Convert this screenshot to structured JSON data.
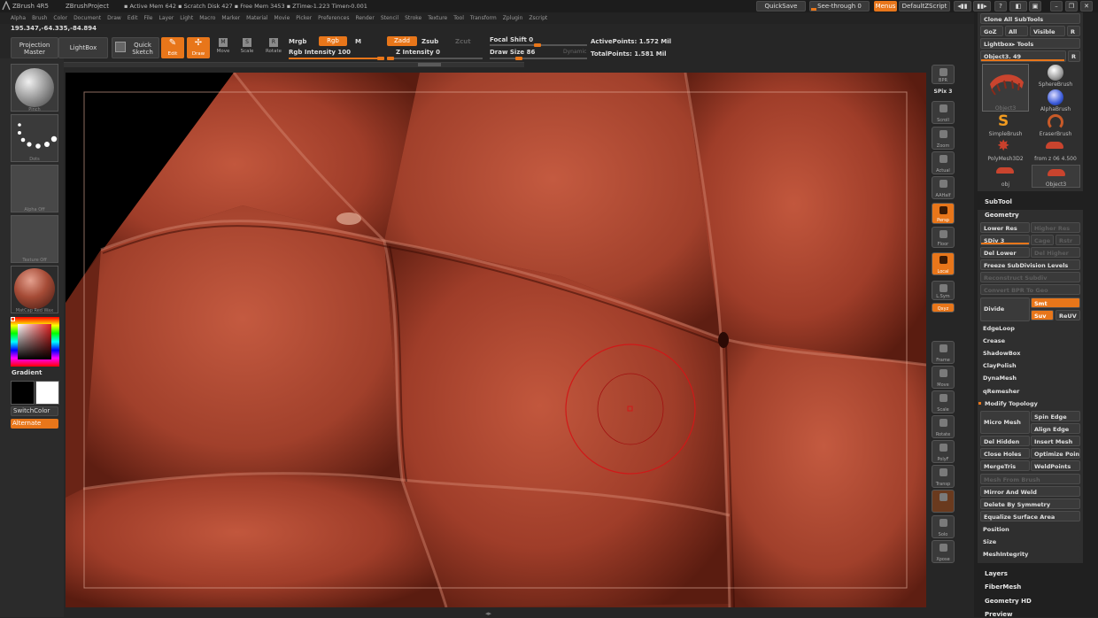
{
  "titlebar": {
    "app": "ZBrush 4R5",
    "project": "ZBrushProject",
    "stats": "▪ Active Mem 642  ▪ Scratch Disk 427  ▪ Free Mem 3453  ▪ ZTime▹1.223  Timer▹0.001",
    "quicksave": "QuickSave",
    "seethrough": "See-through   0",
    "menus": "Menus",
    "script": "DefaultZScript"
  },
  "menubar": [
    "Alpha",
    "Brush",
    "Color",
    "Document",
    "Draw",
    "Edit",
    "File",
    "Layer",
    "Light",
    "Macro",
    "Marker",
    "Material",
    "Movie",
    "Picker",
    "Preferences",
    "Render",
    "Stencil",
    "Stroke",
    "Texture",
    "Tool",
    "Transform",
    "Zplugin",
    "Zscript"
  ],
  "coords": "195.347,-64.335,-84.894",
  "toolbar": {
    "projection_master": "Projection Master",
    "lightbox": "LightBox",
    "quick_sketch": "Quick Sketch",
    "edit": "Edit",
    "draw": "Draw",
    "move": "Move",
    "scale": "Scale",
    "rotate": "Rotate",
    "mrgb": "Mrgb",
    "rgb": "Rgb",
    "m": "M",
    "rgb_intensity": "Rgb Intensity 100",
    "zadd": "Zadd",
    "zsub": "Zsub",
    "zcut": "Zcut",
    "z_intensity": "Z Intensity 0",
    "focal_shift": "Focal Shift 0",
    "draw_size": "Draw Size 86",
    "dynamic": "Dynamic",
    "active_points": "ActivePoints: 1.572  Mil",
    "total_points": "TotalPoints: 1.581  Mil"
  },
  "leftshelf": {
    "brush": "Pinch",
    "stroke": "Dots",
    "alpha": "Alpha Off",
    "texture": "Texture Off",
    "material": "MatCap Red Wax",
    "gradient": "Gradient",
    "switchcolor": "SwitchColor",
    "alternate": "Alternate"
  },
  "colors": {
    "accent": "#e8761a",
    "leather": "#9c3a26",
    "cursor": "#d01818"
  },
  "righttools": [
    {
      "id": "bpr",
      "label": "BPR",
      "on": false
    },
    {
      "id": "spix",
      "label": "SPix 3",
      "on": false
    },
    {
      "id": "scroll",
      "label": "Scroll",
      "on": false
    },
    {
      "id": "zoom",
      "label": "Zoom",
      "on": false
    },
    {
      "id": "actual",
      "label": "Actual",
      "on": false
    },
    {
      "id": "aahalf",
      "label": "AAHalf",
      "on": false
    },
    {
      "id": "persp",
      "label": "Persp",
      "on": true
    },
    {
      "id": "floor",
      "label": "Floor",
      "on": false
    },
    {
      "id": "local",
      "label": "Local",
      "on": true
    },
    {
      "id": "lsym",
      "label": "L.Sym",
      "on": false
    },
    {
      "id": "xyz",
      "label": "Qxyz",
      "on": true
    },
    {
      "id": "frame",
      "label": "Frame",
      "on": false
    },
    {
      "id": "move",
      "label": "Move",
      "on": false
    },
    {
      "id": "scale",
      "label": "Scale",
      "on": false
    },
    {
      "id": "rotate",
      "label": "Rotate",
      "on": false
    },
    {
      "id": "polyf",
      "label": "PolyF",
      "on": false
    },
    {
      "id": "transp",
      "label": "Transp",
      "on": false
    },
    {
      "id": "ghost",
      "label": "",
      "on": false
    },
    {
      "id": "solo",
      "label": "Solo",
      "on": false
    },
    {
      "id": "xpose",
      "label": "Xpose",
      "on": false
    }
  ],
  "tray": {
    "clone": "Clone  All SubTools",
    "goz": "GoZ",
    "all": "All",
    "visible": "Visible",
    "r": "R",
    "lightbox_tools": "Lightbox▸ Tools",
    "object_name": "Object3. 49",
    "tools": [
      "Object3",
      "SphereBrush",
      "AlphaBrush",
      "SimpleBrush",
      "EraserBrush",
      "PolyMesh3D2",
      "from z 06 4.500",
      "obj",
      "Object3"
    ],
    "subtool": "SubTool",
    "geometry": "Geometry",
    "lower_res": "Lower Res",
    "higher_res": "Higher Res",
    "sdiv": "SDiv 3",
    "cage": "Cage",
    "rstr": "Rstr",
    "del_lower": "Del Lower",
    "del_higher": "Del Higher",
    "freeze": "Freeze SubDivision Levels",
    "reconstruct": "Reconstruct Subdiv",
    "convert_bpr": "Convert BPR To Geo",
    "divide": "Divide",
    "smt": "Smt",
    "suv": "Suv",
    "reuv": "ReUV",
    "items1": [
      "EdgeLoop",
      "Crease",
      "ShadowBox",
      "ClayPolish",
      "DynaMesh",
      "qRemesher"
    ],
    "modify_topology": "Modify Topology",
    "spin_edge": "Spin Edge",
    "micro_mesh": "Micro Mesh",
    "align_edge": "Align Edge",
    "del_hidden": "Del Hidden",
    "insert_mesh": "Insert Mesh",
    "close_holes": "Close Holes",
    "optimize": "Optimize Poin",
    "mergetris": "MergeTris",
    "weldpoints": "WeldPoints",
    "mesh_from_brush": "Mesh From Brush",
    "mirror_weld": "Mirror And Weld",
    "delete_symmetry": "Delete By Symmetry",
    "equalize": "Equalize Surface Area",
    "position": "Position",
    "size": "Size",
    "meshintegrity": "MeshIntegrity",
    "layers": "Layers",
    "fibermesh": "FiberMesh",
    "geometry_hd": "Geometry HD",
    "preview": "Preview"
  }
}
